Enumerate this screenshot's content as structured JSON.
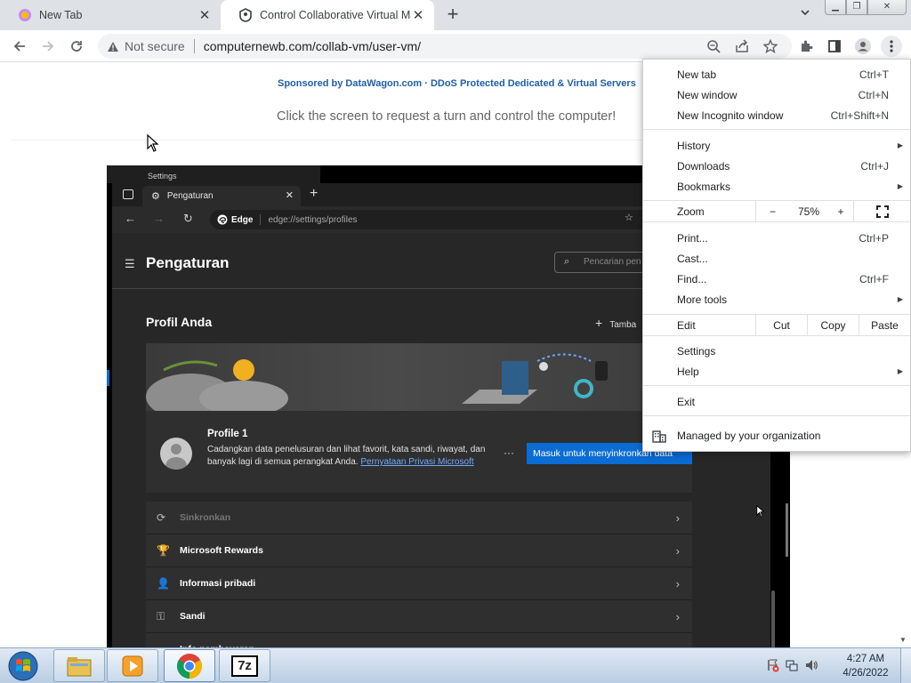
{
  "browser": {
    "tabs": [
      {
        "title": "New Tab"
      },
      {
        "title": "Control Collaborative Virtual Ma"
      }
    ],
    "omnibox": {
      "security_label": "Not secure",
      "url": "computernewb.com/collab-vm/user-vm/"
    }
  },
  "page": {
    "sponsor_text": "Sponsored by DataWagon.com · DDoS Protected Dedicated & Virtual Servers",
    "prompt_text": "Click the screen to request a turn and control the computer!"
  },
  "vm": {
    "window_title": "Settings",
    "edge": {
      "tab_title": "Pengaturan",
      "address_label": "Edge",
      "address_url": "edge://settings/profiles",
      "settings_title": "Pengaturan",
      "search_placeholder": "Pencarian pen",
      "section_title": "Profil Anda",
      "add_profile": "Tamba",
      "profile": {
        "name": "Profile 1",
        "description": "Cadangkan data penelusuran dan lihat favorit, kata sandi, riwayat, dan banyak lagi di semua perangkat Anda.",
        "link": "Pernyataan Privasi Microsoft",
        "more": "···",
        "sync_button": "Masuk untuk menyinkronkan data"
      },
      "rows": [
        {
          "label": "Sinkronkan",
          "icon": "sync-icon",
          "dim": true
        },
        {
          "label": "Microsoft Rewards",
          "icon": "trophy-icon",
          "dim": false
        },
        {
          "label": "Informasi pribadi",
          "icon": "person-icon",
          "dim": false
        },
        {
          "label": "Sandi",
          "icon": "key-icon",
          "dim": false
        },
        {
          "label": "Info pembayaran",
          "icon": "card-icon",
          "dim": false
        }
      ]
    }
  },
  "menu": {
    "new_tab": {
      "label": "New tab",
      "shortcut": "Ctrl+T"
    },
    "new_window": {
      "label": "New window",
      "shortcut": "Ctrl+N"
    },
    "new_incognito": {
      "label": "New Incognito window",
      "shortcut": "Ctrl+Shift+N"
    },
    "history": {
      "label": "History"
    },
    "downloads": {
      "label": "Downloads",
      "shortcut": "Ctrl+J"
    },
    "bookmarks": {
      "label": "Bookmarks"
    },
    "zoom": {
      "label": "Zoom",
      "minus": "−",
      "value": "75%",
      "plus": "+"
    },
    "print": {
      "label": "Print...",
      "shortcut": "Ctrl+P"
    },
    "cast": {
      "label": "Cast..."
    },
    "find": {
      "label": "Find...",
      "shortcut": "Ctrl+F"
    },
    "more_tools": {
      "label": "More tools"
    },
    "edit": {
      "label": "Edit",
      "cut": "Cut",
      "copy": "Copy",
      "paste": "Paste"
    },
    "settings": {
      "label": "Settings"
    },
    "help": {
      "label": "Help"
    },
    "exit": {
      "label": "Exit"
    },
    "managed": {
      "label": "Managed by your organization"
    }
  },
  "taskbar": {
    "time": "4:27 AM",
    "date": "4/26/2022",
    "apps": [
      "explorer-icon",
      "media-player-icon",
      "chrome-icon",
      "7zip-icon"
    ],
    "seven_zip_label": "7z"
  }
}
